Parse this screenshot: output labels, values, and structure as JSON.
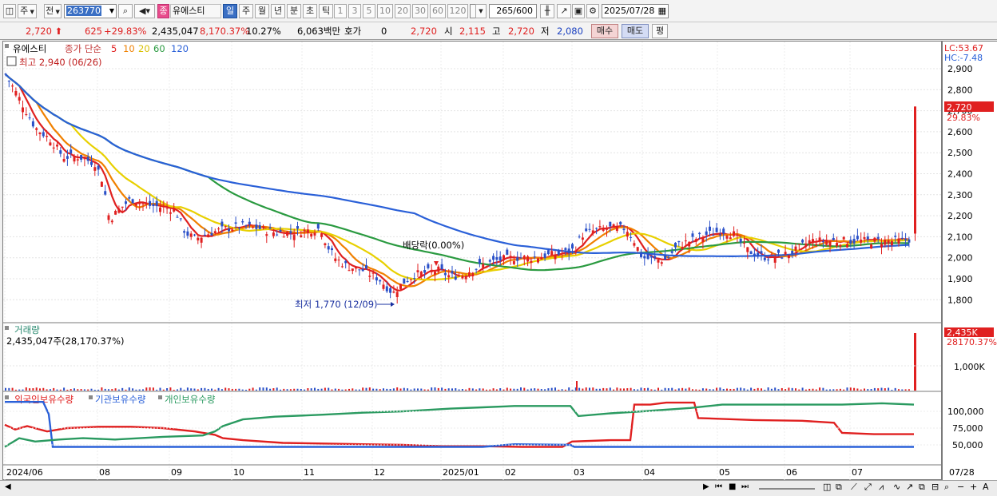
{
  "toolbar": {
    "period_type": "주",
    "mode": "전",
    "code": "263770",
    "stock_tag": "종",
    "stock_name": "유에스티",
    "periods": [
      "일",
      "주",
      "월",
      "년",
      "분",
      "초",
      "틱"
    ],
    "active_period": "일",
    "intervals": [
      "1",
      "3",
      "5",
      "10",
      "20",
      "30",
      "60",
      "120"
    ],
    "count": "265",
    "count_total": "/600",
    "date": "2025/07/28"
  },
  "infobar": {
    "price": "2,720",
    "change": "625",
    "change_pct": "+29.83%",
    "volume": "2,435,047",
    "vol_ratio": "8,170.37%",
    "turnover": "10.27%",
    "amount": "6,063백만",
    "quote_label": "호가",
    "quote_value": "0",
    "quote_price": "2,720",
    "open_label": "시",
    "open": "2,115",
    "high_label": "고",
    "high": "2,720",
    "low_label": "저",
    "low": "2,080",
    "buy_label": "매수",
    "sell_label": "매도",
    "eval_label": "평"
  },
  "legend": {
    "name": "유에스티",
    "ma_label": "종가 단순",
    "ma_periods": [
      "5",
      "10",
      "20",
      "60",
      "120"
    ],
    "ma_colors": [
      "#e02020",
      "#f08000",
      "#e8d000",
      "#2a9a40",
      "#2a60d8"
    ],
    "high_note": "최고 2,940 (06/26)",
    "low_note": "최저 1,770 (12/09)",
    "dividend_note": "배당락(0.00%)"
  },
  "volume_panel": {
    "title": "거래량",
    "value": "2,435,047주(28,170.37%)",
    "axis_label": "1,000K",
    "last_tag": "2,435K",
    "last_sub": "28170.37%"
  },
  "holdings_panel": {
    "series": [
      "외국인보유수량",
      "기관보유수량",
      "개인보유수량"
    ],
    "colors": [
      "#e02020",
      "#2a60d8",
      "#2a9a60"
    ],
    "axis_labels": [
      "100,000",
      "75,000",
      "50,000"
    ]
  },
  "price_axis": {
    "lc": "LC:53.67",
    "hc": "HC:-7.48",
    "labels": [
      "2,900",
      "2,800",
      "2,700",
      "2,600",
      "2,500",
      "2,400",
      "2,300",
      "2,200",
      "2,100",
      "2,000",
      "1,900",
      "1,800"
    ],
    "last_price": "2,720",
    "last_pct": "29.83%"
  },
  "x_axis": {
    "labels": [
      "2024/06",
      "08",
      "09",
      "10",
      "11",
      "12",
      "2025/01",
      "02",
      "03",
      "04",
      "05",
      "06",
      "07"
    ],
    "end_label": "07/28"
  },
  "chart_data": {
    "type": "candlestick",
    "title": "유에스티",
    "y_range": [
      1700,
      3000
    ],
    "x_range": [
      "2024/06",
      "2025/07/28"
    ],
    "price_points": [
      {
        "date": "2024/06/26",
        "value": 2940,
        "label": "최고"
      },
      {
        "date": "2024/12/09",
        "value": 1770,
        "label": "최저"
      },
      {
        "date": "2025/07/28",
        "open": 2115,
        "high": 2720,
        "low": 2080,
        "close": 2720
      }
    ],
    "last_volume": 2435047
  }
}
